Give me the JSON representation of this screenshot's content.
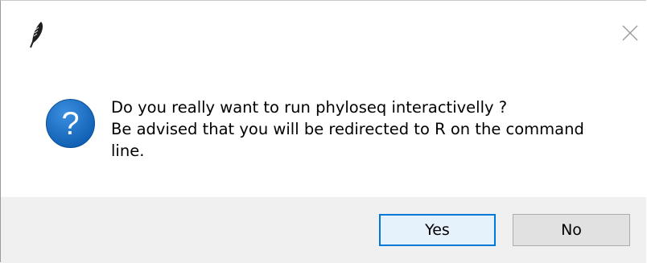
{
  "dialog": {
    "app_icon": "feather-icon",
    "close_icon": "close-icon",
    "question_icon": "question-icon",
    "message_lines": [
      "Do you really want to run phyloseq interactivelly ?",
      "Be advised that you will be redirected to R on the command",
      "line."
    ],
    "buttons": {
      "yes_label": "Yes",
      "no_label": "No"
    }
  },
  "colors": {
    "accent": "#0078d7",
    "question_icon_bg": "#1a6fc4",
    "footer_bg": "#f0f0f0"
  }
}
